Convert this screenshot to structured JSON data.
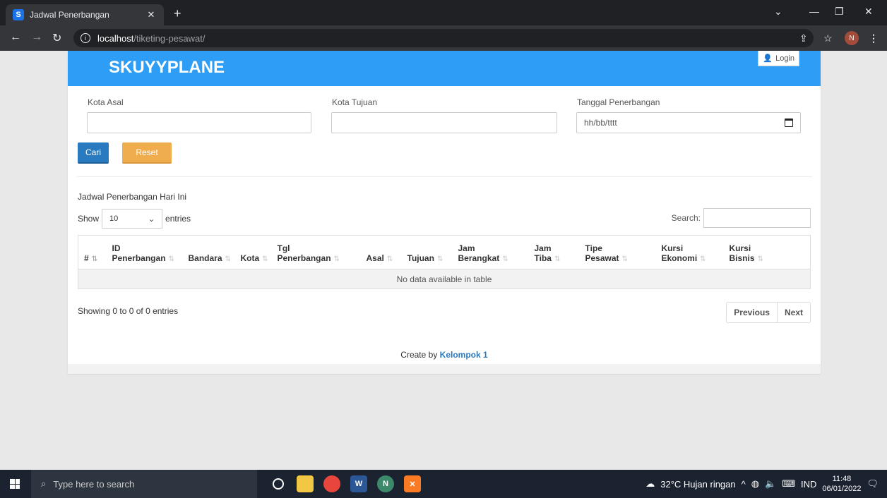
{
  "browser": {
    "tab_title": "Jadwal Penerbangan",
    "favicon_letter": "S",
    "url_host": "localhost",
    "url_path": "/tiketing-pesawat/",
    "profile_initial": "N"
  },
  "header": {
    "brand": "SKUYYPLANE",
    "login_label": "Login"
  },
  "search_form": {
    "origin_label": "Kota Asal",
    "destination_label": "Kota Tujuan",
    "date_label": "Tanggal Penerbangan",
    "date_placeholder": "hh/bb/tttt",
    "search_button": "Cari",
    "reset_button": "Reset"
  },
  "table_section": {
    "title": "Jadwal Penerbangan Hari Ini",
    "show_label": "Show",
    "entries_value": "10",
    "entries_label": "entries",
    "search_label": "Search:",
    "columns": [
      [
        "#",
        ""
      ],
      [
        "ID",
        "Penerbangan"
      ],
      [
        "",
        "Bandara"
      ],
      [
        "",
        "Kota"
      ],
      [
        "Tgl",
        "Penerbangan"
      ],
      [
        "",
        "Asal"
      ],
      [
        "",
        "Tujuan"
      ],
      [
        "Jam",
        "Berangkat"
      ],
      [
        "Jam",
        "Tiba"
      ],
      [
        "Tipe",
        "Pesawat"
      ],
      [
        "Kursi",
        "Ekonomi"
      ],
      [
        "Kursi",
        "Bisnis"
      ]
    ],
    "empty_message": "No data available in table",
    "info": "Showing 0 to 0 of 0 entries",
    "previous": "Previous",
    "next": "Next"
  },
  "footer": {
    "text": "Create by",
    "link": "Kelompok 1"
  },
  "taskbar": {
    "search_placeholder": "Type here to search",
    "weather": "32°C  Hujan ringan",
    "language": "IND",
    "time": "11:48",
    "date": "06/01/2022"
  }
}
